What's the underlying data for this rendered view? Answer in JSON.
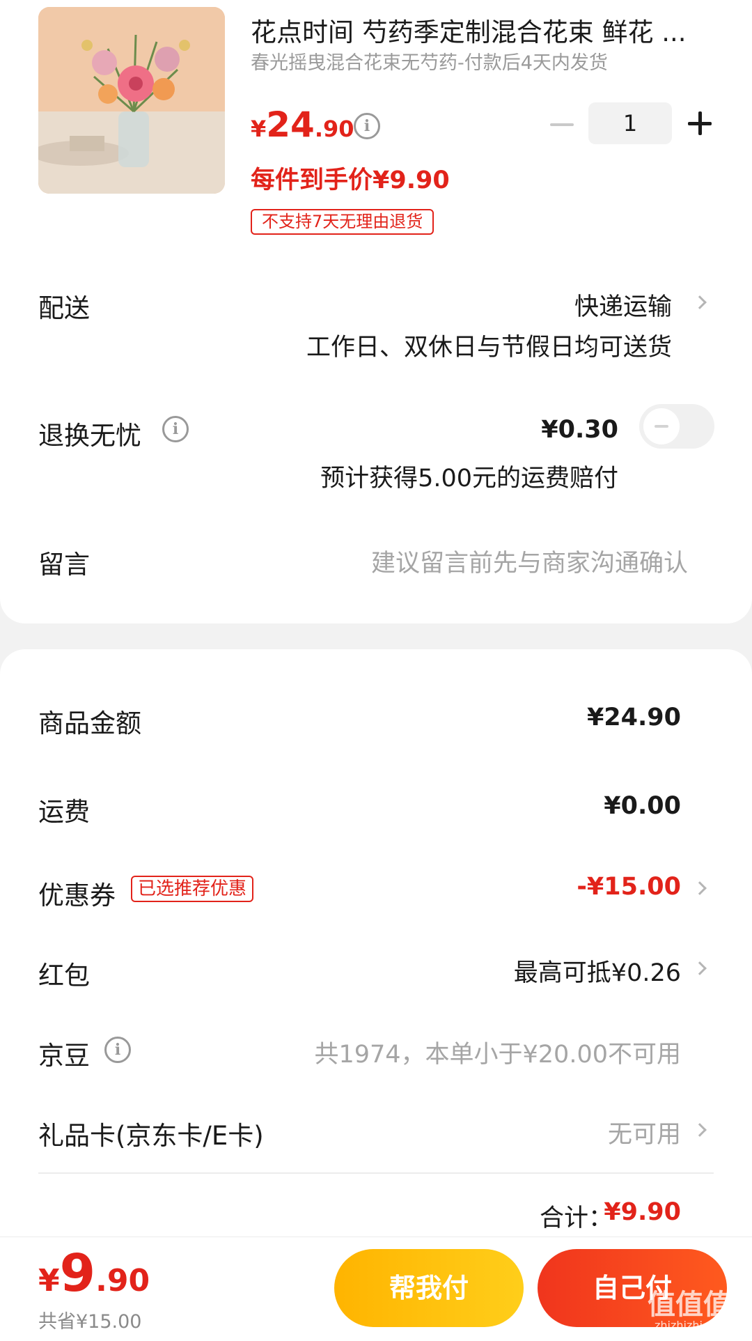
{
  "product": {
    "title": "花点时间 芍药季定制混合花束 鲜花 ...",
    "subtitle": "春光摇曳混合花束无芍药-付款后4天内发货",
    "price_currency": "¥",
    "price_int": "24",
    "price_dec": ".90",
    "each_price": "每件到手价¥9.90",
    "return_badge": "不支持7天无理由退货",
    "quantity": "1"
  },
  "delivery": {
    "label": "配送",
    "method": "快递运输",
    "note": "工作日、双休日与节假日均可送货"
  },
  "return_insurance": {
    "label": "退换无忧",
    "price": "¥0.30",
    "note": "预计获得5.00元的运费赔付",
    "enabled": false
  },
  "message": {
    "label": "留言",
    "placeholder": "建议留言前先与商家沟通确认"
  },
  "summary": {
    "goods_label": "商品金额",
    "goods_value": "¥24.90",
    "shipping_label": "运费",
    "shipping_value": "¥0.00",
    "coupon_label": "优惠券",
    "coupon_badge": "已选推荐优惠",
    "coupon_value": "-¥15.00",
    "redpacket_label": "红包",
    "redpacket_value": "最高可抵¥0.26",
    "jingdou_label": "京豆",
    "jingdou_value": "共1974，本单小于¥20.00不可用",
    "giftcard_label": "礼品卡(京东卡/E卡)",
    "giftcard_value": "无可用",
    "total_label": "合计：",
    "total_value": "¥9.90"
  },
  "bottom_bar": {
    "currency": "¥",
    "total_int": "9",
    "total_dec": ".90",
    "saved": "共省¥15.00",
    "help_pay": "帮我付",
    "self_pay": "自己付"
  },
  "watermark": {
    "text": "值值值",
    "url": "zhizhizhi.com"
  },
  "colors": {
    "accent_red": "#e2231a",
    "help_button": "#ffc107",
    "self_button": "#f5401d"
  }
}
